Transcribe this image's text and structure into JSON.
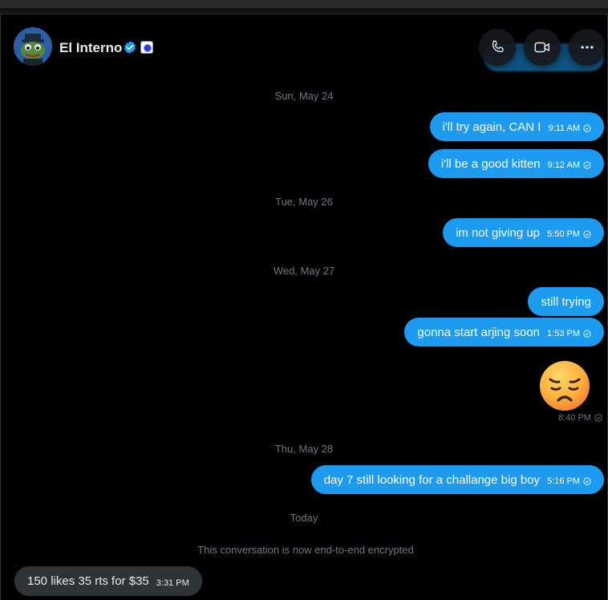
{
  "header": {
    "contact_name": "El Interno",
    "verified_icon": "verified-badge-icon",
    "affiliate_icon": "affiliate-badge-icon",
    "call_icon": "phone-icon",
    "video_icon": "video-camera-icon",
    "more_icon": "more-icon"
  },
  "messages": {
    "date1": "Sun, May 24",
    "m1": {
      "text": "i'll try again, CAN I",
      "time": "9:11 AM"
    },
    "m2": {
      "text": "i'll be a good kitten",
      "time": "9:12 AM"
    },
    "date2": "Tue, May 26",
    "m3": {
      "text": "im not giving up",
      "time": "5:50 PM"
    },
    "date3": "Wed, May 27",
    "m4": {
      "text": "still trying"
    },
    "m5": {
      "text": "gonna start arjing soon",
      "time": "1:53 PM"
    },
    "m6": {
      "emoji": "pensive-face-emoji",
      "time": "8:40 PM"
    },
    "date4": "Thu, May 28",
    "m7": {
      "text": "day 7 still looking for a challange big boy",
      "time": "5:16 PM"
    },
    "date5": "Today",
    "system": "This conversation is now end-to-end encrypted",
    "incoming1": {
      "text": "150 likes 35 rts for $35",
      "time": "3:31 PM"
    }
  },
  "colors": {
    "background": "#000000",
    "outgoing_bubble": "#1d9bf0",
    "incoming_bubble": "#2f3336",
    "muted_text": "#71767b"
  }
}
